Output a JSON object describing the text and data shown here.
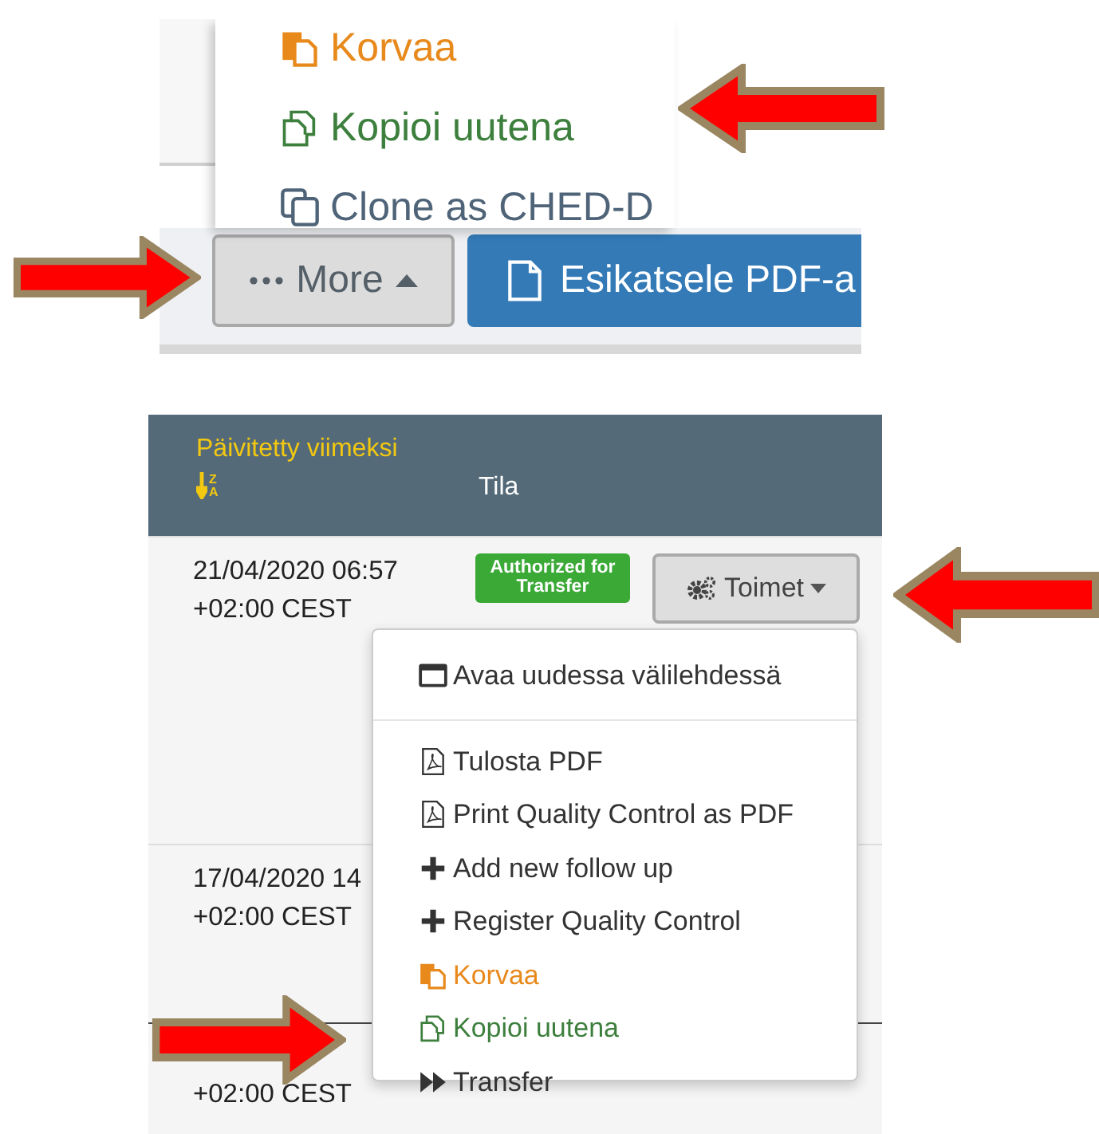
{
  "top_panel": {
    "menu_items": [
      {
        "label": "Korvaa",
        "kind": "replace"
      },
      {
        "label": "Kopioi uutena",
        "kind": "copy"
      },
      {
        "label": "Clone as CHED-D",
        "kind": "clone"
      }
    ],
    "buttons": [
      {
        "label": "More",
        "kind": "more"
      },
      {
        "label": "Esikatsele PDF-a",
        "kind": "preview"
      }
    ]
  },
  "bottom_panel": {
    "columns": [
      {
        "label": "Päivitetty viimeksi",
        "sorted": true,
        "sort_icon": {
          "top": "Z",
          "bottom": "A"
        }
      },
      {
        "label": "Tila",
        "sorted": false
      }
    ],
    "rows": [
      {
        "date": "21/04/2020 06:57",
        "zone": "+02:00 CEST",
        "status": "Authorized for Transfer",
        "action": "Toimet"
      },
      {
        "date": "17/04/2020 14",
        "zone": "+02:00 CEST"
      },
      {
        "zone": "+02:00 CEST"
      }
    ],
    "menu_items": [
      {
        "label": "Avaa uudessa välilehdessä",
        "kind": "tab"
      },
      {
        "label": "Tulosta PDF",
        "kind": "pdf"
      },
      {
        "label": "Print Quality Control as PDF",
        "kind": "pdf"
      },
      {
        "label": "Add new follow up",
        "kind": "plus"
      },
      {
        "label": "Register Quality Control",
        "kind": "plus"
      },
      {
        "label": "Korvaa",
        "kind": "replace"
      },
      {
        "label": "Kopioi uutena",
        "kind": "copy"
      },
      {
        "label": "Transfer",
        "kind": "forward"
      }
    ]
  },
  "arrows": [
    {
      "kind": "left"
    },
    {
      "kind": "right"
    },
    {
      "kind": "left"
    },
    {
      "kind": "right"
    }
  ]
}
